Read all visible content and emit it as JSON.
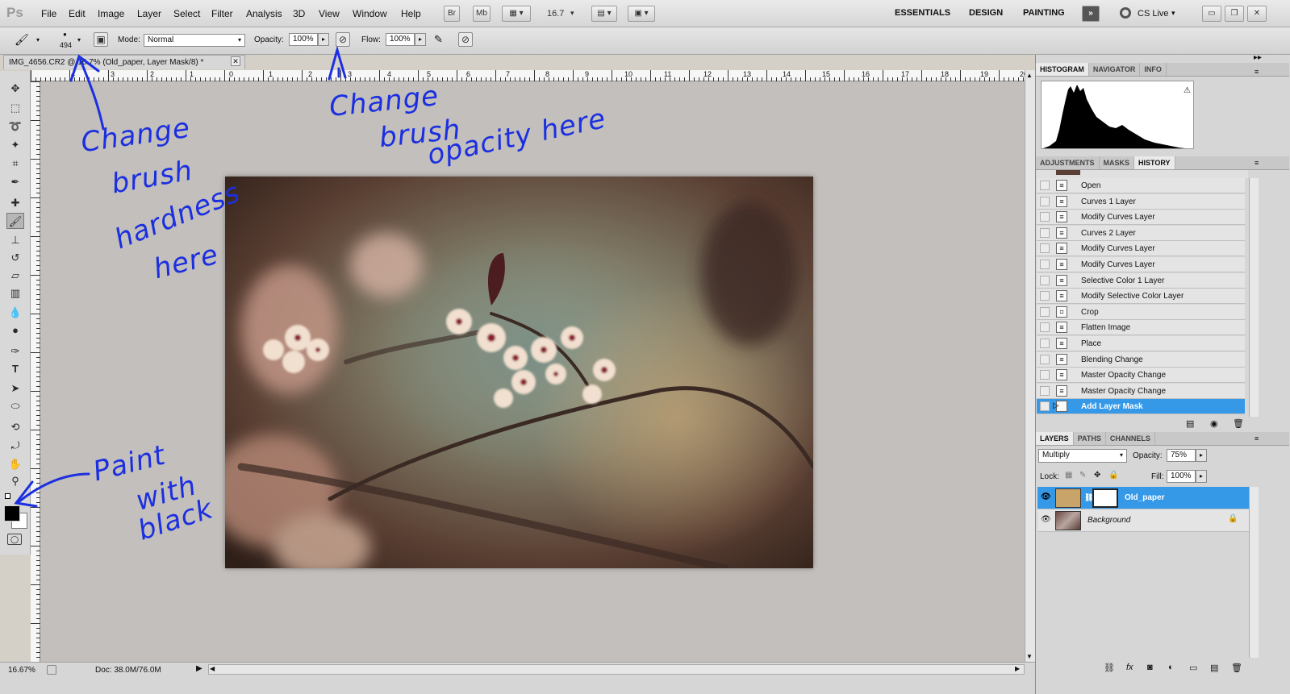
{
  "app": {
    "logo": "Ps"
  },
  "menu": [
    "File",
    "Edit",
    "Image",
    "Layer",
    "Select",
    "Filter",
    "Analysis",
    "3D",
    "View",
    "Window",
    "Help"
  ],
  "appbar": {
    "br": "Br",
    "mb": "Mb",
    "zoom": "16.7"
  },
  "workspaces": [
    "ESSENTIALS",
    "DESIGN",
    "PAINTING"
  ],
  "cs_live": "CS Live",
  "options": {
    "brush_size": "494",
    "mode_label": "Mode:",
    "mode_value": "Normal",
    "opacity_label": "Opacity:",
    "opacity_value": "100%",
    "flow_label": "Flow:",
    "flow_value": "100%"
  },
  "document": {
    "tab_title": "IMG_4656.CR2 @ 16.7% (Old_paper, Layer Mask/8) *"
  },
  "ruler_numbers": [
    "4",
    "3",
    "2",
    "1",
    "0",
    "1",
    "2",
    "3",
    "4",
    "5",
    "6",
    "7",
    "8",
    "9",
    "10",
    "11",
    "12",
    "13",
    "14",
    "15",
    "16",
    "17",
    "18",
    "19",
    "20"
  ],
  "status": {
    "zoom": "16.67%",
    "doc": "Doc: 38.0M/76.0M"
  },
  "panels": {
    "top_tabs": [
      "HISTOGRAM",
      "NAVIGATOR",
      "INFO"
    ],
    "mid_tabs": [
      "ADJUSTMENTS",
      "MASKS",
      "HISTORY"
    ],
    "history": [
      {
        "label": "Open",
        "icon": "document-icon"
      },
      {
        "label": "Curves 1 Layer",
        "icon": "document-icon"
      },
      {
        "label": "Modify Curves Layer",
        "icon": "document-icon"
      },
      {
        "label": "Curves 2 Layer",
        "icon": "document-icon"
      },
      {
        "label": "Modify Curves Layer",
        "icon": "document-icon"
      },
      {
        "label": "Modify Curves Layer",
        "icon": "document-icon"
      },
      {
        "label": "Selective Color 1 Layer",
        "icon": "document-icon"
      },
      {
        "label": "Modify Selective Color Layer",
        "icon": "document-icon"
      },
      {
        "label": "Crop",
        "icon": "crop-icon"
      },
      {
        "label": "Flatten Image",
        "icon": "document-icon"
      },
      {
        "label": "Place",
        "icon": "document-icon"
      },
      {
        "label": "Blending Change",
        "icon": "document-icon"
      },
      {
        "label": "Master Opacity Change",
        "icon": "document-icon"
      },
      {
        "label": "Master Opacity Change",
        "icon": "document-icon"
      },
      {
        "label": "Add Layer Mask",
        "icon": "document-icon"
      }
    ],
    "layers_tabs": [
      "LAYERS",
      "PATHS",
      "CHANNELS"
    ],
    "blend_mode": "Multiply",
    "opacity_label": "Opacity:",
    "opacity_value": "75%",
    "lock_label": "Lock:",
    "fill_label": "Fill:",
    "fill_value": "100%",
    "layers": [
      {
        "name": "Old_paper",
        "selected": true
      },
      {
        "name": "Background",
        "selected": false
      }
    ]
  },
  "annotations": {
    "hardness": [
      "Change",
      "brush",
      "hardness",
      "here"
    ],
    "opacity": [
      "Change",
      "brush",
      "opacity here"
    ],
    "paint": [
      "Paint",
      "with",
      "black"
    ]
  },
  "colors": {
    "accent": "#3599e8",
    "annotation": "#1b2fe0"
  }
}
